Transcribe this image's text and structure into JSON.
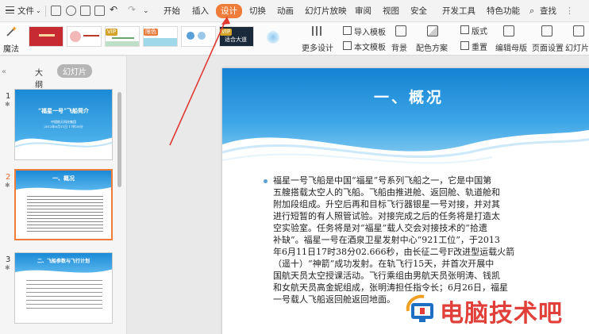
{
  "menubar": {
    "file_label": "文件",
    "tabs": [
      "开始",
      "插入",
      "设计",
      "切换",
      "动画",
      "幻灯片放映",
      "审阅",
      "视图",
      "安全",
      "开发工具",
      "特色功能"
    ],
    "search_label": "查找",
    "accent": "#f07c3a"
  },
  "ribbon": {
    "magic_label": "魔法",
    "more_design": "更多设计",
    "import_template": "导入模板",
    "body_template": "本文模板",
    "background": "背景",
    "color_scheme": "配色方案",
    "layout": "版式",
    "reset": "重置",
    "edit_master": "编辑母版",
    "page_setup": "页面设置",
    "slide_size": "幻灯片大",
    "badge_vip": "VIP",
    "badge_color": "限色",
    "thumb_text": "适合大道"
  },
  "leftpane": {
    "tab_outline": "大纲",
    "tab_slides": "幻灯片",
    "slides": [
      {
        "num": "1",
        "title": "“福星一号”飞船简介",
        "sub1": "中国航天科技集团",
        "sub2": "2013年6月11日 17时38分"
      },
      {
        "num": "2",
        "title": "一、概况"
      },
      {
        "num": "3",
        "title": "二、飞船参数与飞行计划"
      }
    ]
  },
  "slide": {
    "title": "一、概况",
    "lines": [
      "福星一号飞船是中国“福星”号系列飞船之一，它是中国第",
      "五艘搭载太空人的飞船。飞船由推进舱、返回舱、轨道舱和",
      "附加段组成。升空后再和目标飞行器银星一号对接，并对其",
      "进行短暂的有人照管试验。对接完成之后的任务将是打造太",
      "空实验室。任务将是对“福星”载人交会对接技术的“拾遗",
      "补缺”。福星一号在酒泉卫星发射中心“921工位”，于2013",
      "年6月11日17时38分02.666秒，由长征二号F改进型运载火箭",
      "（遥十）“神箭”成功发射。在轨飞行15天，并首次开展中",
      "国航天员太空授课活动。飞行乘组由男航天员张明涛、钱凯",
      "和女航天员高金妮组成，张明涛担任指令长；6月26日，福星",
      "一号载人飞船返回舱返回地面。"
    ]
  },
  "watermark": {
    "text": "电脑技术吧",
    "color": "#e1403a"
  }
}
